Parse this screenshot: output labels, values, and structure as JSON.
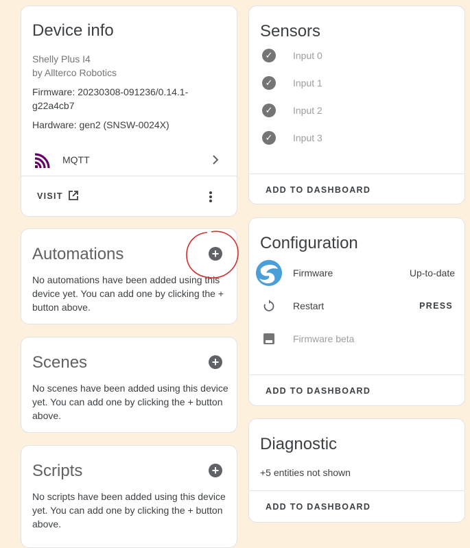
{
  "device_info": {
    "title": "Device info",
    "model": "Shelly Plus I4",
    "manufacturer": "by Allterco Robotics",
    "firmware_line1": "Firmware: 20230308-091236/0.14.1-",
    "firmware_line2": "g22a4cb7",
    "hardware": "Hardware: gen2 (SNSW-0024X)",
    "integration": "MQTT",
    "visit_label": "VISIT"
  },
  "automations": {
    "title": "Automations",
    "empty_line1": "No automations have been added using this",
    "empty_line2": "device yet. You can add one by clicking the +",
    "empty_line3": "button above."
  },
  "scenes": {
    "title": "Scenes",
    "empty_line1": "No scenes have been added using this device",
    "empty_line2": "yet. You can add one by clicking the + button",
    "empty_line3": "above."
  },
  "scripts": {
    "title": "Scripts",
    "empty_line1": "No scripts have been added using this device",
    "empty_line2": "yet. You can add one by clicking the + button",
    "empty_line3": "above."
  },
  "sensors": {
    "title": "Sensors",
    "items": [
      "Input 0",
      "Input 1",
      "Input 2",
      "Input 3"
    ],
    "add_to_dashboard": "ADD TO DASHBOARD"
  },
  "configuration": {
    "title": "Configuration",
    "firmware_label": "Firmware",
    "firmware_state": "Up-to-date",
    "restart_label": "Restart",
    "press_label": "PRESS",
    "firmware_beta_label": "Firmware beta",
    "add_to_dashboard": "ADD TO DASHBOARD"
  },
  "diagnostic": {
    "title": "Diagnostic",
    "hidden_entities": "+5 entities not shown",
    "add_to_dashboard": "ADD TO DASHBOARD"
  },
  "colors": {
    "background": "#fdf1dd",
    "icon_grey": "#5f6368",
    "mqtt_purple": "#660066",
    "annotation_red": "#d32f2f"
  },
  "icons": {
    "mqtt": "mqtt-logo-icon",
    "open_in_new": "open-in-new-icon",
    "chevron": "chevron-right-icon",
    "more": "more-vert-icon",
    "add": "plus-circle-icon",
    "check": "check-circle-icon",
    "firmware_logo": "shelly-logo-icon",
    "restart": "restart-icon",
    "beta": "memory-icon"
  }
}
